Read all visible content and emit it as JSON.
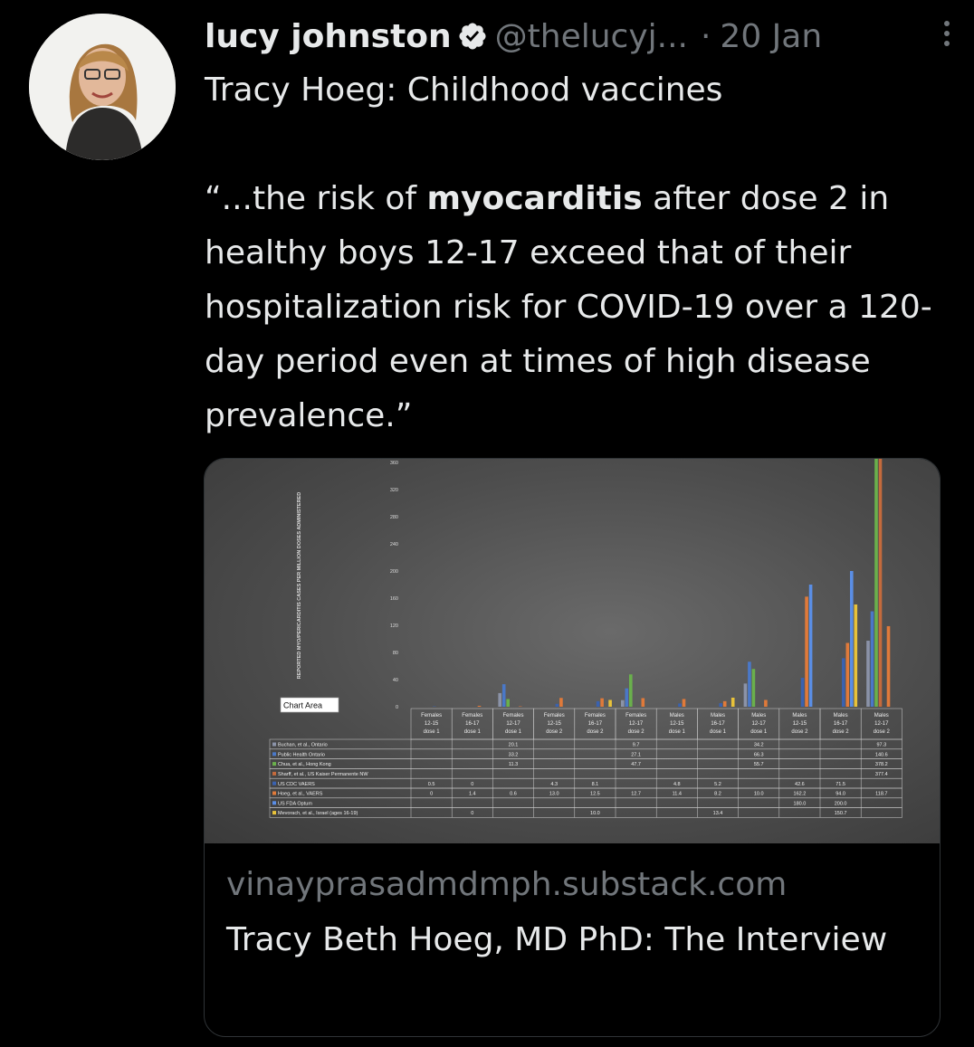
{
  "tweet": {
    "author_name": "lucy johnston",
    "handle": "@thelucyj...",
    "separator": "·",
    "timestamp": "20 Jan",
    "text_line1": "Tracy Hoeg: Childhood vaccines",
    "quote_prefix": "“...the risk of ",
    "quote_bold": "myocarditis",
    "quote_suffix": " after dose 2 in healthy boys 12-17 exceed that of their hospitalization risk for COVID-19 over a 120-day period even at times of high disease prevalence.”"
  },
  "icons": {
    "verified": "verified-badge-icon",
    "more": "more-vertical-icon"
  },
  "colors": {
    "background": "#000000",
    "text": "#e7e9ea",
    "muted": "#71767b",
    "border": "#2f3336"
  },
  "link_card": {
    "domain": "vinayprasadmdmph.substack.com",
    "title": "Tracy Beth Hoeg, MD PhD: The Interview"
  },
  "chart_data": {
    "type": "bar",
    "ylabel": "REPORTED MYO/PERICARDITIS CASES PER MILLION DOSES ADMINISTERED",
    "ylim": [
      0,
      360
    ],
    "yticks": [
      0,
      40,
      80,
      120,
      160,
      200,
      240,
      280,
      320,
      360
    ],
    "tooltip": "Chart Area",
    "categories": [
      [
        "Females",
        "12-15",
        "dose 1"
      ],
      [
        "Females",
        "16-17",
        "dose 1"
      ],
      [
        "Females",
        "12-17",
        "dose 1"
      ],
      [
        "Females",
        "12-15",
        "dose 2"
      ],
      [
        "Females",
        "16-17",
        "dose 2"
      ],
      [
        "Females",
        "12-17",
        "dose 2"
      ],
      [
        "Males",
        "12-15",
        "dose 1"
      ],
      [
        "Males",
        "16-17",
        "dose 1"
      ],
      [
        "Males",
        "12-17",
        "dose 1"
      ],
      [
        "Males",
        "12-15",
        "dose 2"
      ],
      [
        "Males",
        "16-17",
        "dose 2"
      ],
      [
        "Males",
        "12-17",
        "dose 2"
      ]
    ],
    "series": [
      {
        "name": "Buchan, et al., Ontario",
        "color": "#8b93a8",
        "values": [
          null,
          null,
          "20.1",
          null,
          null,
          "9.7",
          null,
          null,
          "34.2",
          null,
          null,
          "97.3"
        ]
      },
      {
        "name": "Public Health Ontario",
        "color": "#4a78c8",
        "values": [
          null,
          null,
          "33.2",
          null,
          null,
          "27.1",
          null,
          null,
          "66.3",
          null,
          null,
          "140.6"
        ]
      },
      {
        "name": "Chua, et al., Hong Kong",
        "color": "#6ab04c",
        "values": [
          null,
          null,
          "11.3",
          null,
          null,
          "47.7",
          null,
          null,
          "55.7",
          null,
          null,
          "378.2"
        ]
      },
      {
        "name": "Sharff, et al., US Kaiser Permanente NW",
        "color": "#c46a3c",
        "values": [
          null,
          null,
          null,
          null,
          null,
          null,
          null,
          null,
          null,
          null,
          null,
          "377.4"
        ]
      },
      {
        "name": "US CDC VAERS",
        "color": "#3a62b0",
        "values": [
          "0.5",
          "0",
          null,
          "4.3",
          "8.1",
          null,
          "4.8",
          "5.2",
          null,
          "42.6",
          "71.5",
          null
        ]
      },
      {
        "name": "Hoeg, et al., VAERS",
        "color": "#e07a3a",
        "values": [
          "0",
          "1.4",
          "0.6",
          "13.0",
          "12.5",
          "12.7",
          "11.4",
          "8.2",
          "10.0",
          "162.2",
          "94.0",
          "118.7"
        ]
      },
      {
        "name": "US FDA Optum",
        "color": "#5a8ee6",
        "values": [
          null,
          null,
          null,
          null,
          null,
          null,
          null,
          null,
          null,
          "180.0",
          "200.0",
          null
        ]
      },
      {
        "name": "Mevorach, et al., Israel (ages 16-19)",
        "color": "#e8c23a",
        "values": [
          null,
          "0",
          null,
          null,
          "10.0",
          null,
          null,
          "13.4",
          null,
          null,
          "150.7",
          null
        ]
      }
    ]
  }
}
